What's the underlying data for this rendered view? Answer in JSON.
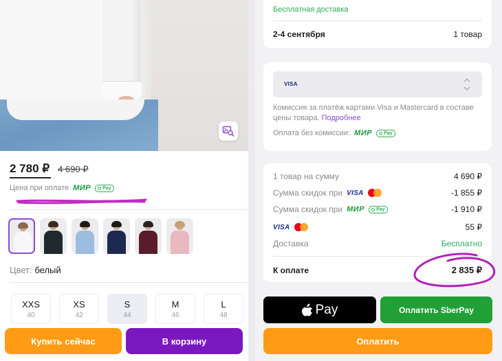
{
  "product": {
    "price_current": "2 780 ₽",
    "price_old": "4 690 ₽",
    "payment_note": "Цена при оплате",
    "mir_logo": "МИР",
    "pay_badge": "Pay",
    "color_label": "Цвет:",
    "color_value": "белый",
    "thumbnails": [
      {
        "shirt": "#f7f7f7",
        "hair": "#8a6a4a"
      },
      {
        "shirt": "#1f2a2c",
        "hair": "#3b2a20"
      },
      {
        "shirt": "#9cbde0",
        "hair": "#1e1a18"
      },
      {
        "shirt": "#1d2952",
        "hair": "#1e1a18"
      },
      {
        "shirt": "#5a1c2a",
        "hair": "#2a2020"
      },
      {
        "shirt": "#e8b7bf",
        "hair": "#caa070"
      }
    ],
    "sizes": [
      {
        "name": "XXS",
        "num": "40"
      },
      {
        "name": "XS",
        "num": "42"
      },
      {
        "name": "S",
        "num": "44"
      },
      {
        "name": "M",
        "num": "46"
      },
      {
        "name": "L",
        "num": "48"
      }
    ],
    "selected_size": "S",
    "buy_now_label": "Купить сейчас",
    "add_to_cart_label": "В корзину"
  },
  "checkout": {
    "free_delivery": "Бесплатная доставка",
    "delivery_dates": "2-4 сентября",
    "delivery_count": "1 товар",
    "card_brand": "VISA",
    "commission_text": "Комиссия за платёж картами Visa и Mastercard в составе цены товара.",
    "commission_link": "Подробнее",
    "no_fee_label": "Оплата без комиссии:",
    "summary": {
      "items_label": "1 товар на сумму",
      "items_value": "4 690 ₽",
      "discount_card_label": "Сумма скидок при",
      "discount_card_value": "-1 855 ₽",
      "discount_mir_label": "Сумма скидок при",
      "discount_mir_value": "-1 910 ₽",
      "card_fee_value": "55 ₽",
      "delivery_label": "Доставка",
      "delivery_value": "Бесплатно",
      "total_label": "К оплате",
      "total_value": "2 835 ₽"
    },
    "apple_pay_label": "Pay",
    "sberpay_label": "Оплатить SberPay",
    "pay_label": "Оплатить"
  },
  "colors": {
    "accent_purple": "#7a18c0",
    "accent_orange": "#ff9b14",
    "green": "#21a038",
    "scribble_pink": "#c02cc4"
  }
}
